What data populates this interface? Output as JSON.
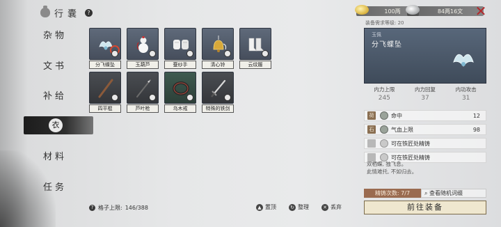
{
  "header": {
    "title": "行囊",
    "help": "?"
  },
  "currency": {
    "gold": "100两",
    "silver": "84两16文"
  },
  "close_symbol": "✕",
  "tabs": [
    {
      "label": "杂物"
    },
    {
      "label": "文书"
    },
    {
      "label": "补给"
    },
    {
      "label": ""
    },
    {
      "label": "材料"
    },
    {
      "label": "任务"
    }
  ],
  "active_tab_icon": "衣",
  "items": [
    {
      "name": "分飞蝶坠",
      "icon": "butterfly-pendant-icon",
      "equipped": true
    },
    {
      "name": "玉葫芦",
      "icon": "gourd-icon"
    },
    {
      "name": "蚕纱手",
      "icon": "gloves-icon"
    },
    {
      "name": "清心铃",
      "icon": "bell-icon"
    },
    {
      "name": "云纹履",
      "icon": "boots-icon"
    },
    {
      "name": "四平棍",
      "icon": "staff-icon"
    },
    {
      "name": "芦叶枪",
      "icon": "spear-icon"
    },
    {
      "name": "乌木戒",
      "icon": "ring-icon"
    },
    {
      "name": "特殊的铁剑",
      "icon": "sword-icon"
    }
  ],
  "capacity": {
    "label": "格子上限:",
    "value": "146/388"
  },
  "bottom_actions": {
    "pin": "置顶",
    "organize": "整理",
    "discard": "丢弃"
  },
  "detail": {
    "requirement": "装备需求等级: 20",
    "quality": "玉佩",
    "name": "分飞蝶坠",
    "stats": [
      {
        "label": "内力上限",
        "value": "245"
      },
      {
        "label": "内力回复",
        "value": "37"
      },
      {
        "label": "内功攻击",
        "value": "31"
      }
    ],
    "attributes": [
      {
        "tag": "荷",
        "name": "命中",
        "value": "12"
      },
      {
        "tag": "石",
        "name": "气血上限",
        "value": "98"
      },
      {
        "tag": "",
        "name": "可在铁匠处精铸",
        "value": ""
      },
      {
        "tag": "",
        "name": "可在铁匠处精铸",
        "value": ""
      }
    ],
    "flavor_lines": [
      "双栖蝶, 独飞息。",
      "此情难托, 不如归去。"
    ],
    "refine_count": "精铸次数: 7/7",
    "refine_link": "查看随机词缀",
    "go_equip": "前往装备"
  }
}
